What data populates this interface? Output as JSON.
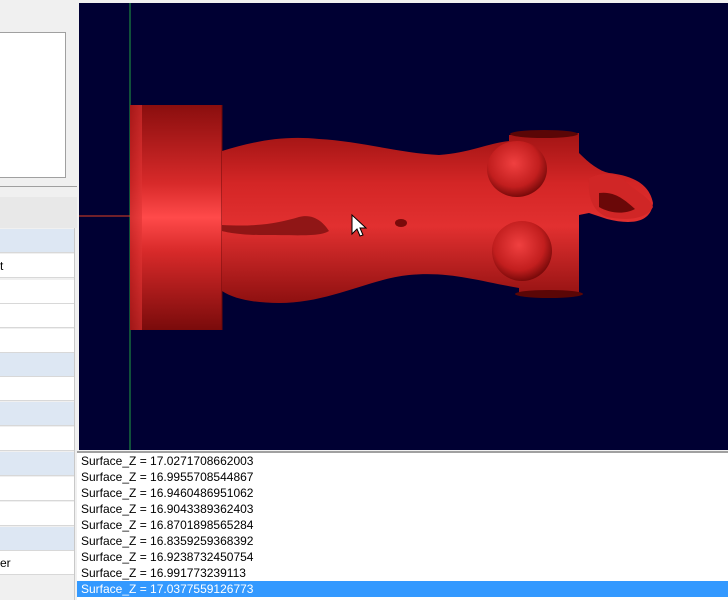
{
  "left_panel": {
    "rows": [
      {
        "shade": "blue",
        "text": ""
      },
      {
        "shade": "white",
        "text": "t"
      },
      {
        "shade": "white",
        "text": ""
      },
      {
        "shade": "white",
        "text": ""
      },
      {
        "shade": "white",
        "text": ""
      },
      {
        "shade": "blue",
        "text": ""
      },
      {
        "shade": "white",
        "text": ""
      },
      {
        "shade": "blue",
        "text": ""
      },
      {
        "shade": "white",
        "text": ""
      },
      {
        "shade": "blue",
        "text": ""
      },
      {
        "shade": "white",
        "text": ""
      },
      {
        "shade": "white",
        "text": ""
      },
      {
        "shade": "blue",
        "text": ""
      },
      {
        "shade": "white",
        "text": "er"
      }
    ]
  },
  "viewport": {
    "background": "#000033",
    "model_color": "#cc1a1a",
    "axis_x_color": "#e04020",
    "axis_y_color": "#20a040"
  },
  "log": {
    "lines": [
      "Surface_Z = 17.0271708662003",
      "Surface_Z = 16.9955708544867",
      "Surface_Z = 16.9460486951062",
      "Surface_Z = 16.9043389362403",
      "Surface_Z = 16.8701898565284",
      "Surface_Z = 16.8359259368392",
      "Surface_Z = 16.9238732450754",
      "Surface_Z = 16.991773239113",
      "Surface_Z = 17.0377559126773"
    ],
    "selected_index": 8
  }
}
